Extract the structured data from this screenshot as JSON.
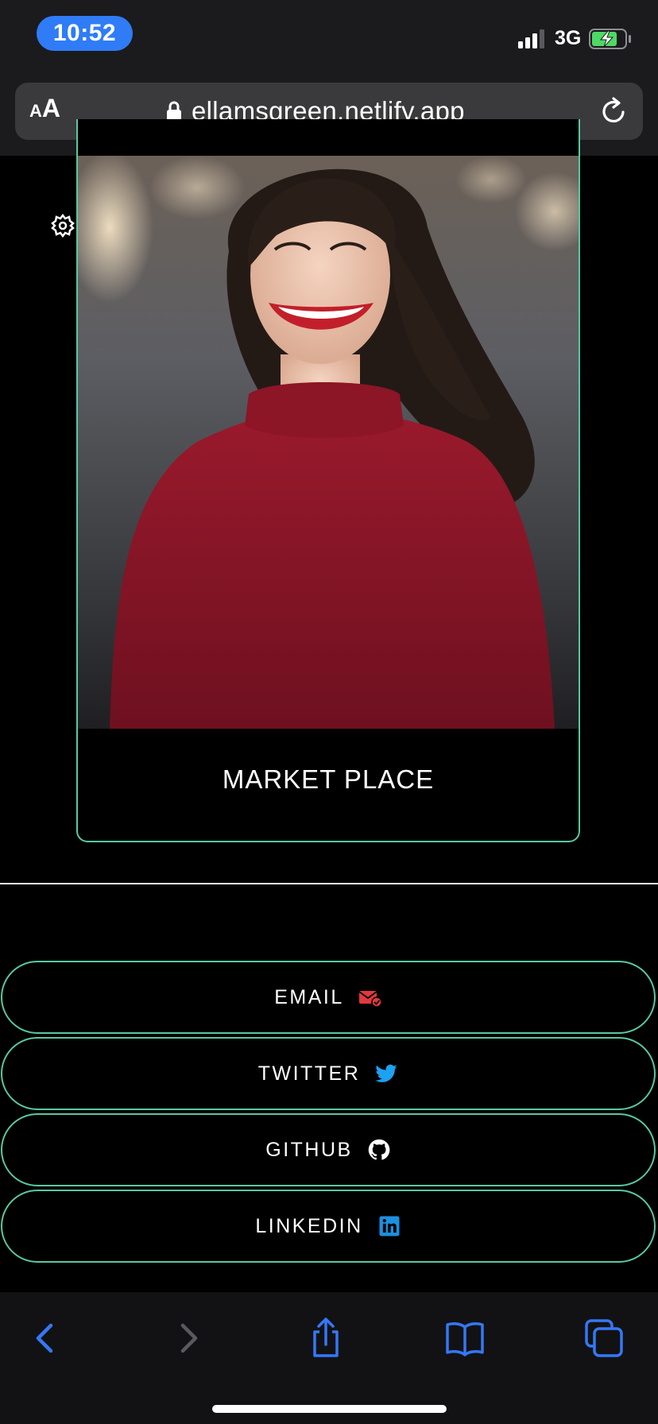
{
  "status_bar": {
    "time": "10:52",
    "network": "3G",
    "battery_charging": true,
    "battery_level": 0.7,
    "battery_color": "#4cd964",
    "time_pill_color": "#2f7cf6"
  },
  "browser": {
    "text_size_small": "A",
    "text_size_big": "A",
    "url": "ellamsgreen.netlify.app",
    "lock_icon": "lock-icon",
    "reload_icon": "reload-icon"
  },
  "card": {
    "title": "MARKET PLACE",
    "image": "portrait-photo-woman-red-sweater",
    "border_color": "#57c9a2"
  },
  "settings_icon": "gear-icon",
  "links": [
    {
      "label": "EMAIL",
      "icon": "email-check-icon",
      "icon_color": "#e0393e"
    },
    {
      "label": "TWITTER",
      "icon": "twitter-icon",
      "icon_color": "#1da1f2"
    },
    {
      "label": "GITHUB",
      "icon": "github-icon",
      "icon_color": "#ffffff"
    },
    {
      "label": "LINKEDIN",
      "icon": "linkedin-icon",
      "icon_color": "#1d8fe0"
    }
  ],
  "toolbar": {
    "accent": "#3478f6",
    "items": [
      "back-icon",
      "forward-icon",
      "share-icon",
      "bookmarks-icon",
      "tabs-icon"
    ]
  }
}
